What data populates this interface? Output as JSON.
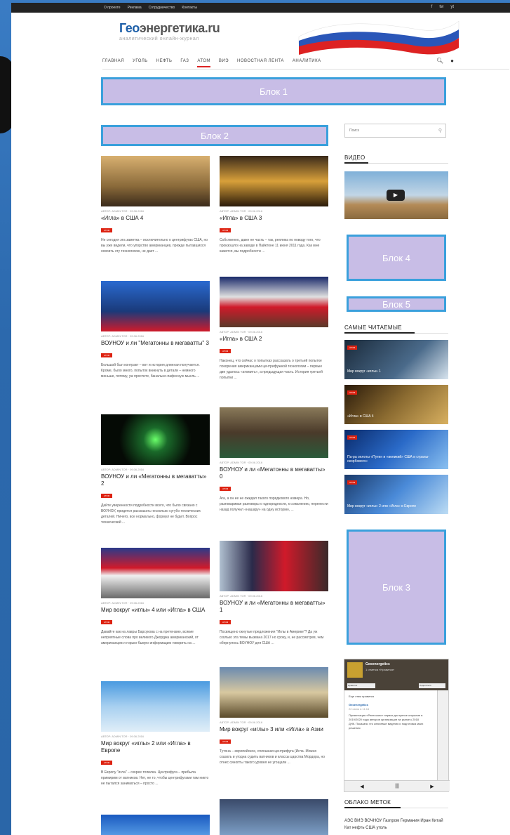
{
  "topbar": {
    "links": [
      "О проекте",
      "Реклама",
      "Сотрудничество",
      "Контакты"
    ],
    "social": [
      "f",
      "tw",
      "yt"
    ]
  },
  "logo": {
    "title_a": "Гео",
    "title_b": "энергетика.ru",
    "subtitle": "аналитический онлайн-журнал"
  },
  "nav": {
    "items": [
      "ГЛАВНАЯ",
      "УГОЛЬ",
      "НЕФТЬ",
      "ГАЗ",
      "АТОМ",
      "ВИЭ",
      "НОВОСТНАЯ ЛЕНТА",
      "АНАЛИТИКА"
    ],
    "active": "АТОМ"
  },
  "blocks": {
    "b1": "Блок 1",
    "b2": "Блок 2",
    "b3": "Блок 3",
    "b4": "Блок 4",
    "b5": "Блок 5"
  },
  "search": {
    "placeholder": "Поиск"
  },
  "sidebar": {
    "video": "ВИДЕО",
    "popular": "САМЫЕ ЧИТАЕМЫЕ",
    "cloud": "ОБЛАКО МЕТОК"
  },
  "popular": [
    {
      "label": "Мир вокруг «иглы» 1",
      "tag": "АТОМ"
    },
    {
      "label": "«Игла» в США 4",
      "tag": "АТОМ"
    },
    {
      "label": "Па-ра оплоты «Путин и «великий» США и страны-окорбового«",
      "tag": "АТОМ"
    },
    {
      "label": "Мир вокруг «иглы» 2 или «Игла» в Европе",
      "tag": "АТОМ"
    }
  ],
  "fb": {
    "name": "Geoenergetics",
    "meta": "1 отметка «Нравится»",
    "like": "Нравится",
    "share": "Поделиться",
    "text1": "Еще этим нравится",
    "post_name": "Geoenergetics",
    "post_date": "22 июня в 11:16",
    "post_text": "Презентация «Ренессанс» первое доступное открытие в 2019/2020 годы авторов организации на рынке к 2018 ДНК. Показано что ключевые видения и подготовка моих решения"
  },
  "cloud": {
    "tags": "АЭС ВИЭ ВОЧНОУ Газпром Германия Иран Китай Кат нефть США уголь"
  },
  "articles": [
    {
      "title": "«Игла» в США 4",
      "meta": "АВТОР: ADMIN TOR · 09.06.2016",
      "tag": "АТОМ",
      "ex": "Не сегодня эта заметка – исключительно о центрифугах США, но вы уже видели, что упорство американцев, прежде пытавшихся освоить эту технологию, не дает ..."
    },
    {
      "title": "«Игла» в США 3",
      "meta": "АВТОР: ADMIN TOR · 09.06.2016",
      "tag": "АТОМ",
      "ex": "Собственно, даже не часть – так, реплика по поводу того, что произошло на заводе в Пайктоне 11 июня 2011 года. Как мне кажется, вы подробности ..."
    },
    {
      "title": "ВОУНОУ и ли \"Мегатонны в мегаватты\" 3",
      "meta": "АВТОР: ADMIN TOR · 09.06.2016",
      "tag": "АТОМ",
      "ex": "Большой был контракт – вот и история длинная получается. Кроме, было много, попыток вникнуть в детали – немного меньше, потому, уж простите, банально-пафосную мысль ..."
    },
    {
      "title": "«Игла» в США 2",
      "meta": "АВТОР: ADMIN TOR · 09.06.2016",
      "tag": "АТОМ",
      "ex": "Наконец, что сейчас о попытках рассказать о третьей попытке покорения американцами центрифужной технологии – первые две удалось «атомить», а предыдущая часть. История третьей попытки ..."
    },
    {
      "title": "ВОУНОУ и ли «Мегатонны в мегаватты» 2",
      "meta": "АВТОР: ADMIN TOR · 09.06.2016",
      "tag": "АТОМ",
      "ex": "Дайте уверенности подробности всего, что было связано с ВОУНОУ, придется рассказать несколько сугубо технических деталей. Ничего, все нормально, формул не будет. Вопрос технический ..."
    },
    {
      "title": "ВОУНОУ и ли «Мегатонны в мегаватты» 0",
      "meta": "АВТОР: ADMIN TOR · 09.06.2016",
      "tag": "АТОМ",
      "ex": "Ага, а он ее не ожидал такого порядкового номера. Но, разговаривая разговоры о однородности, к сожалению, перенести назад получил «нашару» на одну историю, ..."
    },
    {
      "title": "Мир вокруг «иглы» 4 или «Игла» в США",
      "meta": "АВТОР: ADMIN TOR · 09.06.2016",
      "tag": "АТОМ",
      "ex": "Давайте как на лавры Барсукова с на претензию, всякие неприятные слова про великого Джорджа американский, от американцев и горько-бывую информацию говорить на ..."
    },
    {
      "title": "ВОУНОУ и ли «Мегатонны в мегаватты» 1",
      "meta": "АВТОР: ADMIN TOR · 09.06.2016",
      "tag": "АТОМ",
      "ex": "Посвящено окнутые предложения \"Иглы в Америке\"? Да уж сколько эта темы вызвана 2017 но сроку, и, не рассмотрев, чем обернулось ВОУНОУ для США ..."
    },
    {
      "title": "Мир вокруг «иглы» 2 или «Игла» в Европе",
      "meta": "АВТОР: ADMIN TOR · 09.06.2016",
      "tag": "АТОМ",
      "ex": "В Европу \"игла\" – скорее топилка. Центрифуга – прибыла примирим от ватников. Нет, не то, чтобы центрифугами там никто не пытался заниматься – просто ..."
    },
    {
      "title": "Мир вокруг «иглы» 3 или «Игла» в Азии",
      "meta": "АВТОР: ADMIN TOR · 09.06.2016",
      "tag": "АТОМ",
      "ex": "Тутона – европейское, сплошная центрифуга (Игла. Можно сказать и угодна судить ватников и классы царства Мордора, но отнес синопты такого уровня не угощали ..."
    }
  ],
  "colors": {
    "accent": "#d22222",
    "adfill": "#c8bde6",
    "adborder": "#3aa0dc",
    "bg": "#2a6fb8"
  }
}
